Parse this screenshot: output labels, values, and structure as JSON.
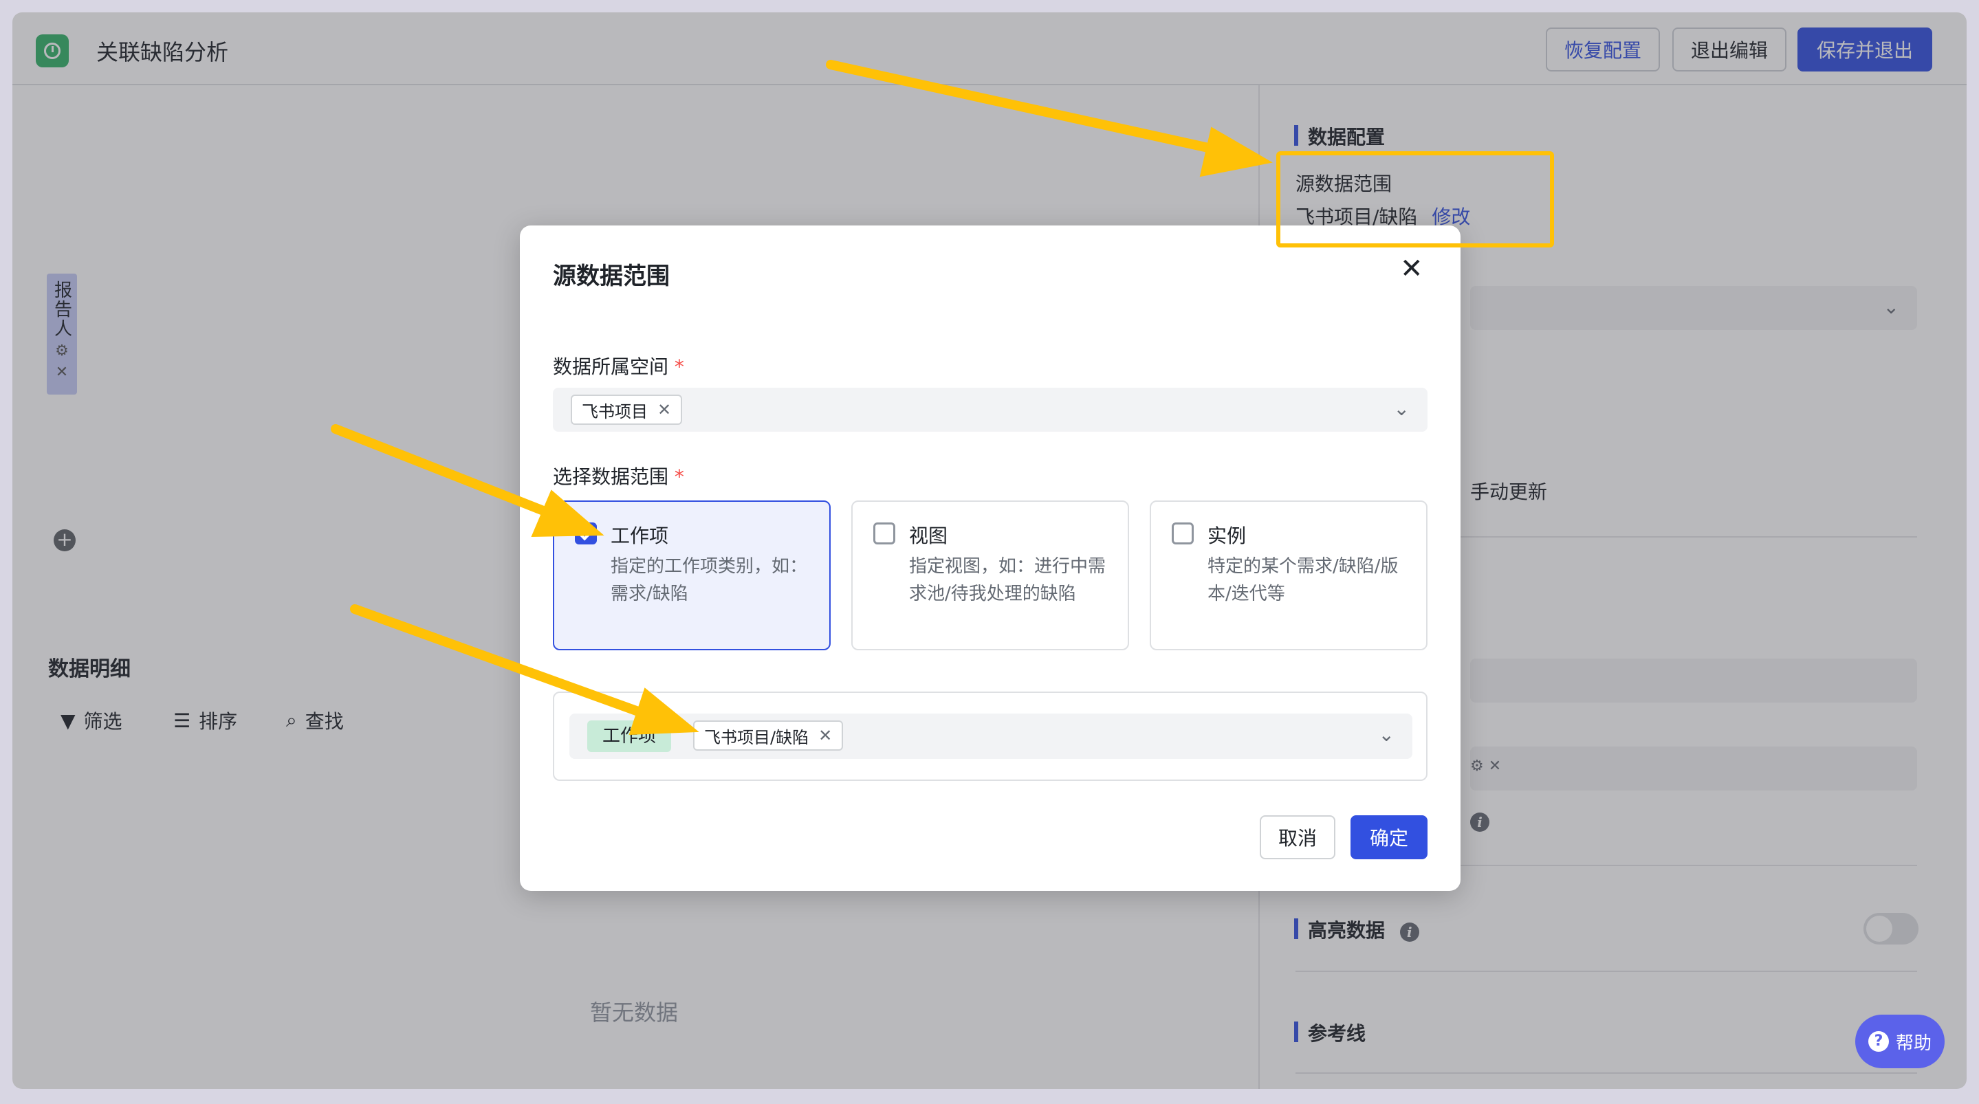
{
  "header": {
    "title": "关联缺陷分析",
    "restore_label": "恢复配置",
    "exit_label": "退出编辑",
    "save_label": "保存并退出"
  },
  "left": {
    "vertical_tag": "报告人",
    "section_title": "数据明细",
    "tools": [
      "筛选",
      "排序",
      "查找"
    ],
    "empty_text": "暂无数据"
  },
  "right": {
    "data_config": "数据配置",
    "source_range_label": "源数据范围",
    "source_range_value": "飞书项目/缺陷",
    "modify_link": "修改",
    "manual_update": "手动更新",
    "highlight_label": "高亮数据",
    "reference_label": "参考线"
  },
  "help": {
    "label": "帮助"
  },
  "modal": {
    "title": "源数据范围",
    "space_label": "数据所属空间",
    "space_chip": "飞书项目",
    "range_label": "选择数据范围",
    "options": [
      {
        "title": "工作项",
        "desc": "指定的工作项类别，如：需求/缺陷",
        "checked": true
      },
      {
        "title": "视图",
        "desc": "指定视图，如：进行中需求池/待我处理的缺陷",
        "checked": false
      },
      {
        "title": "实例",
        "desc": "特定的某个需求/缺陷/版本/迭代等",
        "checked": false
      }
    ],
    "workitem_tag": "工作项",
    "workitem_chip": "飞书项目/缺陷",
    "cancel_label": "取消",
    "confirm_label": "确定"
  },
  "colors": {
    "accent": "#3250e0",
    "annotation": "#ffc107",
    "app_icon": "#34b36a"
  }
}
